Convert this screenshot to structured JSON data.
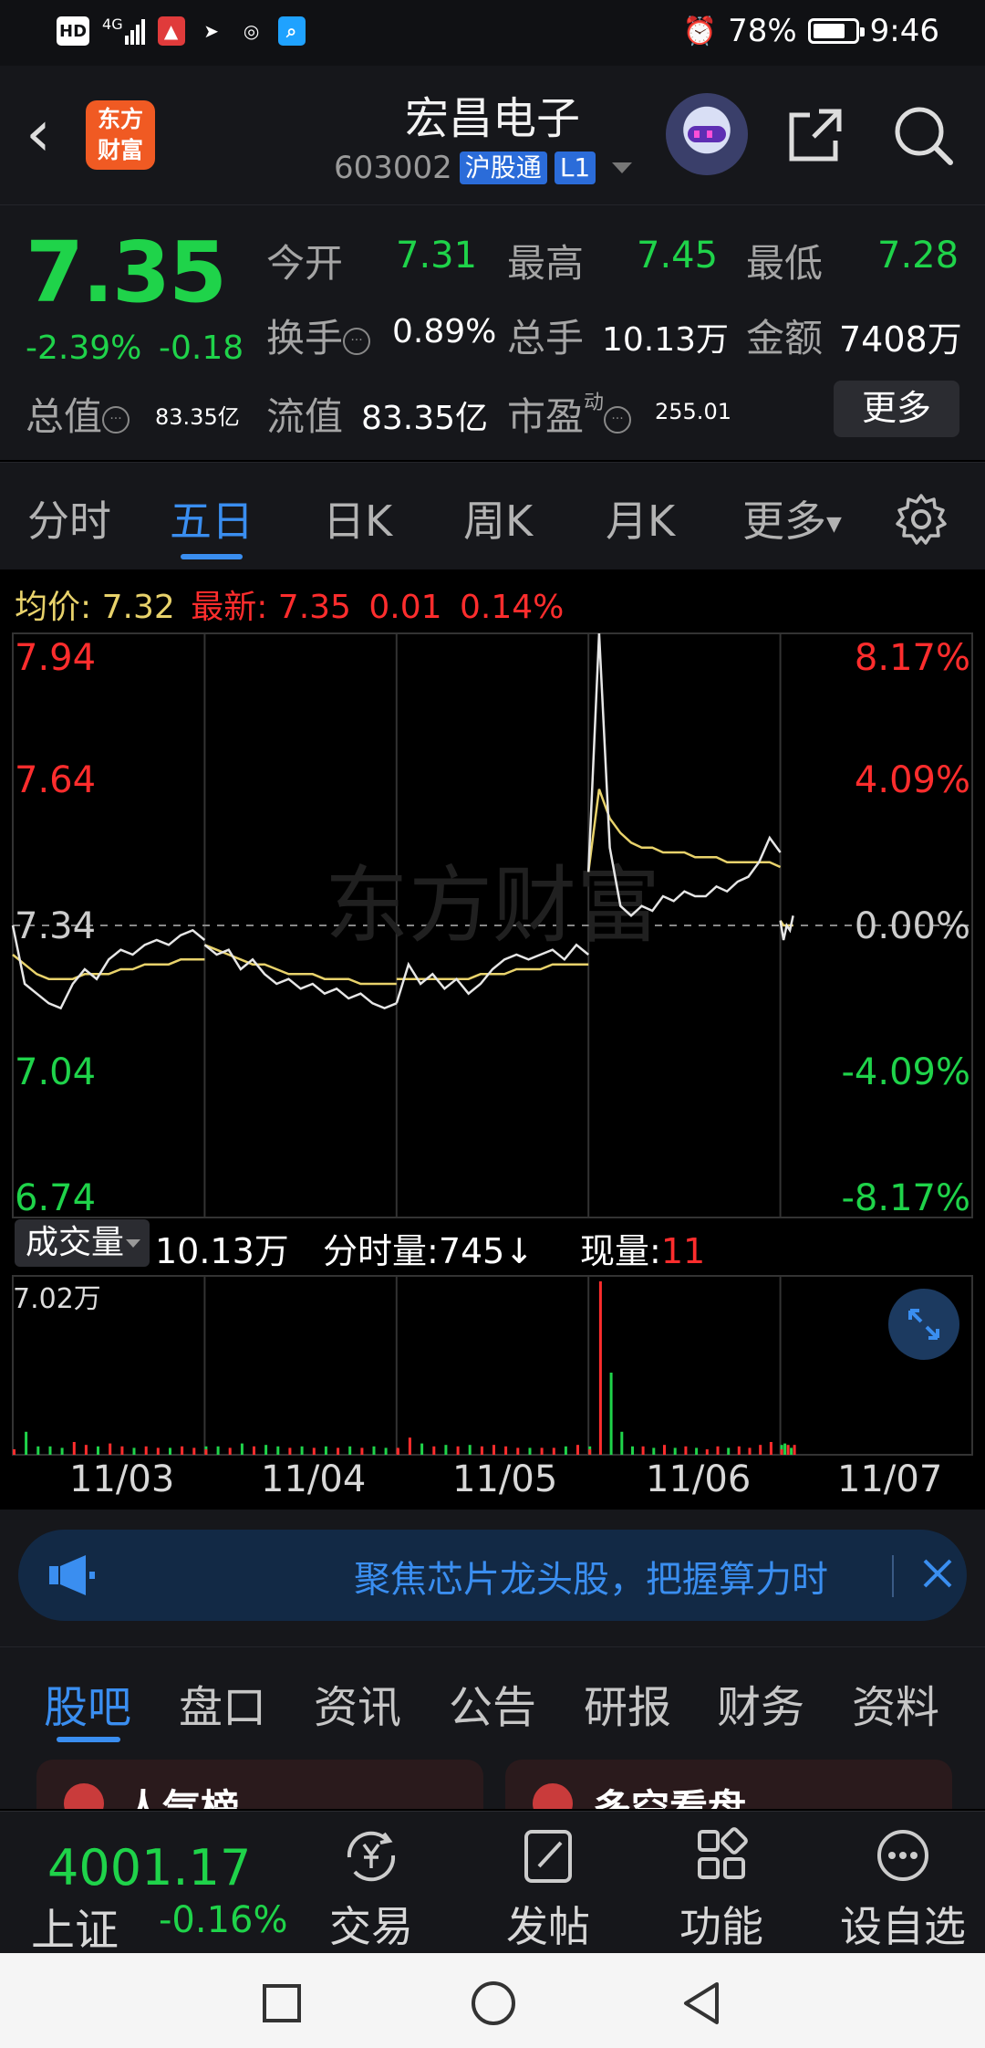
{
  "status_bar": {
    "hd": "HD",
    "net": "4G",
    "battery_percent": 78,
    "battery_label": "78%",
    "time": "9:46"
  },
  "header": {
    "logo_text": "东方财富",
    "title": "宏昌电子",
    "code": "603002",
    "exchange_tag": "沪股通",
    "level_tag": "L1"
  },
  "quote": {
    "price": "7.35",
    "change_pct": "-2.39%",
    "change": "-0.18",
    "open_label": "今开",
    "open": "7.31",
    "high_label": "最高",
    "high": "7.45",
    "low_label": "最低",
    "low": "7.28",
    "turnover_label": "换手",
    "turnover": "0.89%",
    "volume_label": "总手",
    "volume": "10.13万",
    "amount_label": "金额",
    "amount": "7408万",
    "mcap_label": "总值",
    "mcap": "83.35亿",
    "float_label": "流值",
    "float_mcap": "83.35亿",
    "pe_label": "市盈",
    "pe_super": "动",
    "pe": "255.01",
    "more": "更多"
  },
  "tabs": [
    "分时",
    "五日",
    "日K",
    "周K",
    "月K",
    "更多"
  ],
  "active_tab": "五日",
  "chart_header": {
    "avg_label": "均价:",
    "avg": "7.32",
    "latest_label": "最新:",
    "latest": "7.35",
    "latest_change": "0.01",
    "latest_pct": "0.14%"
  },
  "chart_data": {
    "type": "line",
    "price_ticks": [
      "7.94",
      "7.64",
      "7.34",
      "7.04",
      "6.74"
    ],
    "pct_ticks": [
      "8.17%",
      "4.09%",
      "0.00%",
      "-4.09%",
      "-8.17%"
    ],
    "ylim": [
      6.74,
      7.94
    ],
    "dates": [
      "11/03",
      "11/04",
      "11/05",
      "11/06",
      "11/07"
    ],
    "watermark": "东方财富",
    "colors": {
      "price": "#e6e6e6",
      "avg": "#e8d26b",
      "up": "#ff2d2d",
      "down": "#1fd34a"
    },
    "series": [
      {
        "day": "11/03",
        "close": [
          7.34,
          7.22,
          7.2,
          7.18,
          7.17,
          7.22,
          7.25,
          7.23,
          7.27,
          7.29,
          7.28,
          7.3,
          7.31,
          7.3,
          7.32,
          7.33,
          7.31
        ],
        "avg": [
          7.28,
          7.26,
          7.24,
          7.23,
          7.23,
          7.23,
          7.24,
          7.24,
          7.24,
          7.25,
          7.25,
          7.26,
          7.26,
          7.26,
          7.27,
          7.27,
          7.27
        ]
      },
      {
        "day": "11/04",
        "close": [
          7.3,
          7.28,
          7.29,
          7.25,
          7.27,
          7.24,
          7.22,
          7.23,
          7.21,
          7.22,
          7.2,
          7.21,
          7.19,
          7.2,
          7.18,
          7.17,
          7.18
        ],
        "avg": [
          7.3,
          7.29,
          7.28,
          7.27,
          7.26,
          7.26,
          7.25,
          7.24,
          7.24,
          7.24,
          7.23,
          7.23,
          7.23,
          7.22,
          7.22,
          7.22,
          7.22
        ]
      },
      {
        "day": "11/05",
        "close": [
          7.18,
          7.26,
          7.22,
          7.24,
          7.21,
          7.23,
          7.2,
          7.22,
          7.25,
          7.27,
          7.28,
          7.27,
          7.28,
          7.29,
          7.27,
          7.3,
          7.28
        ],
        "avg": [
          7.23,
          7.23,
          7.23,
          7.23,
          7.23,
          7.23,
          7.23,
          7.24,
          7.24,
          7.24,
          7.25,
          7.25,
          7.25,
          7.26,
          7.26,
          7.26,
          7.26
        ]
      },
      {
        "day": "11/06",
        "close": [
          7.45,
          7.94,
          7.5,
          7.38,
          7.36,
          7.38,
          7.37,
          7.4,
          7.39,
          7.41,
          7.4,
          7.4,
          7.42,
          7.41,
          7.43,
          7.44,
          7.47,
          7.52,
          7.49
        ],
        "avg": [
          7.45,
          7.62,
          7.56,
          7.53,
          7.51,
          7.5,
          7.5,
          7.49,
          7.49,
          7.49,
          7.48,
          7.48,
          7.48,
          7.47,
          7.47,
          7.47,
          7.47,
          7.47,
          7.46
        ]
      },
      {
        "day": "11/07",
        "close": [
          7.35,
          7.31,
          7.34,
          7.33,
          7.36
        ],
        "avg": [
          7.35,
          7.34,
          7.34,
          7.34,
          7.34
        ]
      }
    ],
    "volume": {
      "label": "成交量",
      "total": "10.13万",
      "max_label": "7.02万",
      "minute_vol_label": "分时量:",
      "minute_vol": "745",
      "minute_vol_arrow": "↓",
      "current_label": "现量:",
      "current": "11"
    }
  },
  "banner": {
    "text": "聚焦芯片龙头股，把握算力时"
  },
  "bottom_tabs": [
    "股吧",
    "盘口",
    "资讯",
    "公告",
    "研报",
    "财务",
    "资料"
  ],
  "cards": [
    "人气榜",
    "多空看盘"
  ],
  "footer": {
    "index_value": "4001.17",
    "index_name": "上证",
    "index_change": "-0.16%",
    "buttons": [
      "交易",
      "发帖",
      "功能",
      "设自选"
    ]
  }
}
